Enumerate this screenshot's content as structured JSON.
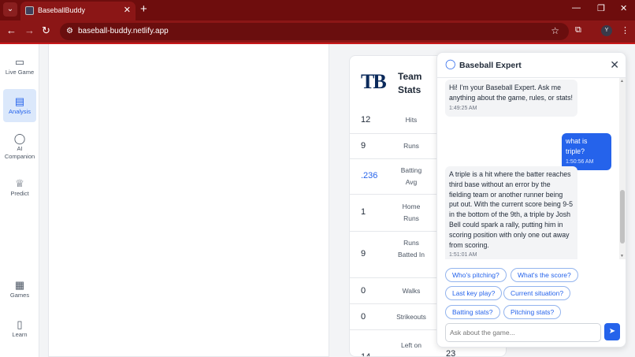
{
  "browser": {
    "tab_title": "BaseballBuddy",
    "tab_close": "✕",
    "new_tab": "+",
    "tab_dropdown": "⌄",
    "url": "baseball-buddy.netlify.app",
    "profile_initial": "Y",
    "minimize": "—",
    "maximize": "❐",
    "close": "✕",
    "back": "←",
    "forward": "→",
    "reload": "↻",
    "star": "☆",
    "extensions": "⧉",
    "menu": "⋮"
  },
  "sidebar": {
    "items": [
      {
        "label": "Live Game",
        "icon": "video-icon",
        "glyph": "▭"
      },
      {
        "label": "Analysis",
        "icon": "chart-icon",
        "glyph": "▤"
      },
      {
        "label": "AI Companion",
        "icon": "chat-bubble-icon",
        "glyph": "◯"
      },
      {
        "label": "Predict",
        "icon": "trophy-icon",
        "glyph": "♕"
      },
      {
        "label": "Games",
        "icon": "calendar-icon",
        "glyph": "▦"
      },
      {
        "label": "Learn",
        "icon": "book-icon",
        "glyph": "▯"
      }
    ]
  },
  "team_stats": {
    "logo": "TB",
    "title": "Team Stats",
    "rows": [
      {
        "value": "12",
        "label": "Hits"
      },
      {
        "value": "9",
        "label": "Runs"
      },
      {
        "value": ".236",
        "label": "Batting Avg"
      },
      {
        "value": "1",
        "label": "Home Runs"
      },
      {
        "value": "9",
        "label": "Runs Batted In"
      },
      {
        "value": "0",
        "label": "Walks"
      },
      {
        "value": "0",
        "label": "Strikeouts"
      },
      {
        "value": "14",
        "label": "Left on"
      }
    ],
    "away_partial": "23"
  },
  "chat": {
    "title": "Baseball Expert",
    "close": "✕",
    "messages": [
      {
        "role": "bot",
        "text": "Hi! I'm your Baseball Expert. Ask me anything about the game, rules, or stats!",
        "time": "1:49:25 AM"
      },
      {
        "role": "user",
        "text": "what is triple?",
        "time": "1:50:56 AM"
      },
      {
        "role": "bot",
        "text": "A triple is a hit where the batter reaches third base without an error by the fielding team or another runner being put out. With the current score being 9-5 in the bottom of the 9th, a triple by Josh Bell could spark a rally, putting him in scoring position with only one out away from scoring.",
        "time": "1:51:01 AM"
      }
    ],
    "quick_replies": [
      "Who's pitching?",
      "What's the score?",
      "Last key play?",
      "Current situation?",
      "Batting stats?",
      "Pitching stats?"
    ],
    "input_placeholder": "Ask about the game...",
    "send_glyph": "➤"
  },
  "colors": {
    "browser_frame": "#8b1616",
    "accent": "#2563eb",
    "team_navy": "#0b2a5b"
  }
}
